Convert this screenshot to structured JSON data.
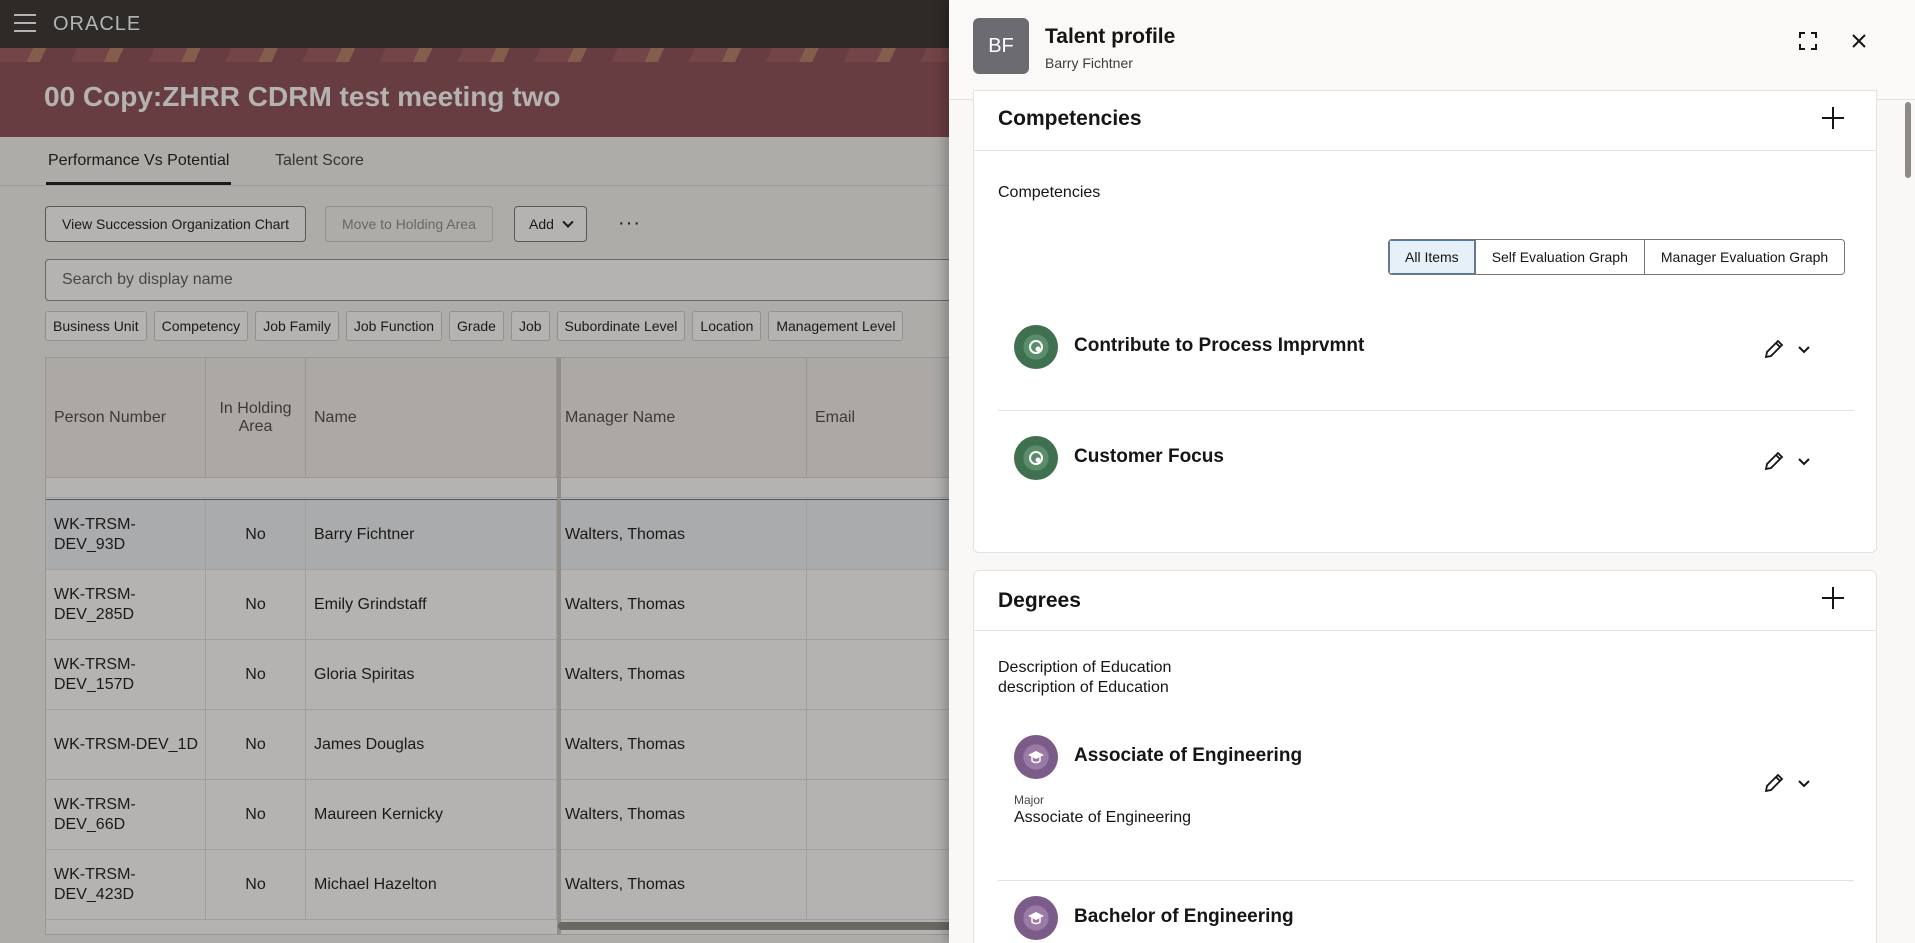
{
  "app": {
    "brand": "ORACLE"
  },
  "banner": {
    "title": "00 Copy:ZHRR CDRM test meeting two"
  },
  "tabs": [
    {
      "label": "Performance Vs Potential",
      "active": true
    },
    {
      "label": "Talent Score",
      "active": false
    }
  ],
  "toolbar": {
    "org_chart_label": "View Succession Organization Chart",
    "holding_label": "Move to Holding Area",
    "add_label": "Add",
    "more_label": "···"
  },
  "search": {
    "placeholder": "Search by display name"
  },
  "filters": [
    "Business Unit",
    "Competency",
    "Job Family",
    "Job Function",
    "Grade",
    "Job",
    "Subordinate Level",
    "Location",
    "Management Level"
  ],
  "table": {
    "columns": [
      "Person Number",
      "In Holding Area",
      "Name",
      "Manager Name",
      "Email"
    ],
    "rows": [
      {
        "person_number": "WK-TRSM-DEV_93D",
        "holding": "No",
        "name": "Barry Fichtner",
        "manager": "Walters, Thomas",
        "email": "",
        "selected": true
      },
      {
        "person_number": "WK-TRSM-DEV_285D",
        "holding": "No",
        "name": "Emily Grindstaff",
        "manager": "Walters, Thomas",
        "email": ""
      },
      {
        "person_number": "WK-TRSM-DEV_157D",
        "holding": "No",
        "name": "Gloria Spiritas",
        "manager": "Walters, Thomas",
        "email": ""
      },
      {
        "person_number": "WK-TRSM-DEV_1D",
        "holding": "No",
        "name": "James Douglas",
        "manager": "Walters, Thomas",
        "email": ""
      },
      {
        "person_number": "WK-TRSM-DEV_66D",
        "holding": "No",
        "name": "Maureen Kernicky",
        "manager": "Walters, Thomas",
        "email": ""
      },
      {
        "person_number": "WK-TRSM-DEV_423D",
        "holding": "No",
        "name": "Michael Hazelton",
        "manager": "Walters, Thomas",
        "email": ""
      }
    ]
  },
  "drawer": {
    "avatar_initials": "BF",
    "title": "Talent profile",
    "subtitle": "Barry Fichtner",
    "competencies": {
      "title": "Competencies",
      "description": "Competencies",
      "views": [
        "All Items",
        "Self Evaluation Graph",
        "Manager Evaluation Graph"
      ],
      "active_view": "All Items",
      "items": [
        "Contribute to Process Imprvmnt",
        "Customer Focus"
      ]
    },
    "degrees": {
      "title": "Degrees",
      "description_line1": "Description of Education",
      "description_line2": "description of Education",
      "items": [
        {
          "title": "Associate of Engineering",
          "major_label": "Major",
          "major": "Associate of Engineering"
        },
        {
          "title": "Bachelor of Engineering"
        }
      ]
    }
  },
  "colors": {
    "topbar": "#312d2a",
    "banner": "#8a4b52",
    "competency_icon": "#3f7150",
    "degree_icon": "#7b5b88"
  }
}
